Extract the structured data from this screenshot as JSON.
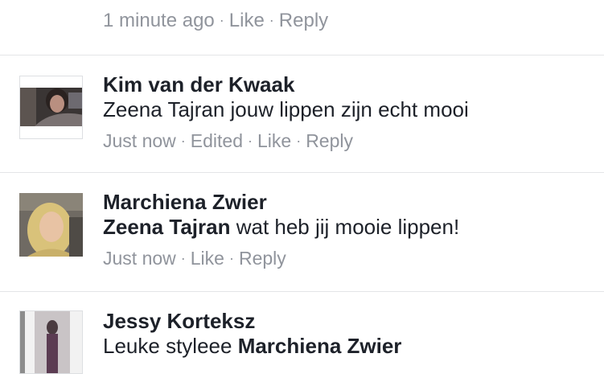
{
  "top_meta": {
    "time": "1 minute ago",
    "like": "Like",
    "reply": "Reply"
  },
  "comments": [
    {
      "author": "Kim van der Kwaak",
      "text_mention": "",
      "text": "Zeena Tajran jouw lippen zijn echt mooi",
      "time": "Just now",
      "edited": "Edited",
      "like": "Like",
      "reply": "Reply"
    },
    {
      "author": "Marchiena Zwier",
      "text_mention": "Zeena Tajran",
      "text": "wat heb jij mooie lippen!",
      "time": "Just now",
      "like": "Like",
      "reply": "Reply"
    },
    {
      "author": "Jessy Korteksz",
      "text_prefix": "Leuke styleee",
      "text_mention": "Marchiena Zwier"
    }
  ]
}
